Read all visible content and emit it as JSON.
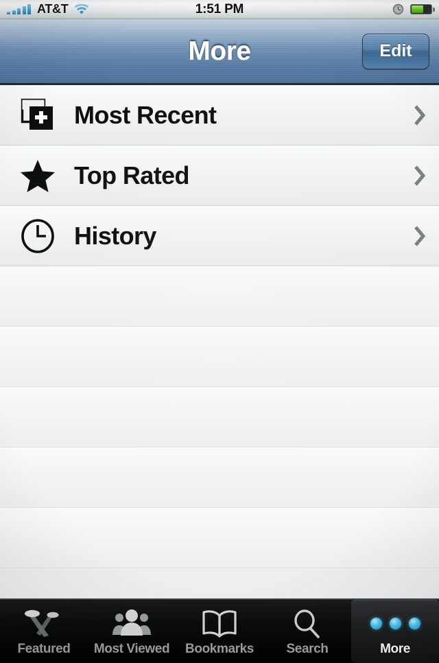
{
  "status_bar": {
    "signal_icon": "signal-bars-icon",
    "signal_bars": 5,
    "carrier": "AT&T",
    "wifi_icon": "wifi-icon",
    "time": "1:51 PM",
    "alarm_icon": "alarm-clock-icon",
    "battery_icon": "battery-icon",
    "battery_level_percent": 62,
    "battery_color": "#73cc26"
  },
  "nav_bar": {
    "title": "More",
    "edit_label": "Edit",
    "accent_color": "#5a7fa6"
  },
  "list": {
    "rows": [
      {
        "label": "Most Recent",
        "icon": "new-document-icon",
        "accessory": "chevron-right-icon"
      },
      {
        "label": "Top Rated",
        "icon": "star-icon",
        "accessory": "chevron-right-icon"
      },
      {
        "label": "History",
        "icon": "clock-icon",
        "accessory": "chevron-right-icon"
      }
    ],
    "empty_rows": 5,
    "separator_color": "#ced4d6"
  },
  "tab_bar": {
    "selected": "More",
    "tabs": [
      {
        "label": "Featured",
        "icon": "spotlights-icon"
      },
      {
        "label": "Most Viewed",
        "icon": "people-group-icon"
      },
      {
        "label": "Bookmarks",
        "icon": "open-book-icon"
      },
      {
        "label": "Search",
        "icon": "magnifier-icon"
      },
      {
        "label": "More",
        "icon": "three-dots-icon"
      }
    ],
    "selected_dot_color": "#4fc6f2"
  }
}
